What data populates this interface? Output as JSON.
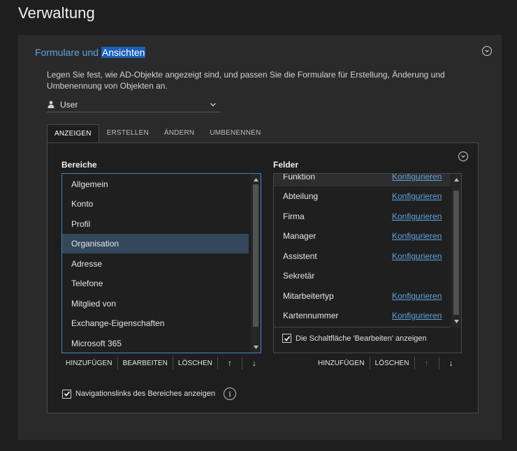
{
  "page": {
    "title": "Verwaltung"
  },
  "section": {
    "title_part1": "Formulare und ",
    "title_part2": "Ansichten",
    "description": "Legen Sie fest, wie AD-Objekte angezeigt sind, und passen Sie die Formulare für Erstellung, Änderung und Umbenennung von Objekten an."
  },
  "object_type": {
    "icon": "user-icon",
    "value": "User"
  },
  "tabs": [
    {
      "label": "ANZEIGEN",
      "active": true
    },
    {
      "label": "ERSTELLEN",
      "active": false
    },
    {
      "label": "ÄNDERN",
      "active": false
    },
    {
      "label": "UMBENENNEN",
      "active": false
    }
  ],
  "bereiche": {
    "label": "Bereiche",
    "items": [
      {
        "label": "Allgemein"
      },
      {
        "label": "Konto"
      },
      {
        "label": "Profil"
      },
      {
        "label": "Organisation",
        "selected": true
      },
      {
        "label": "Adresse"
      },
      {
        "label": "Telefone"
      },
      {
        "label": "Mitglied von"
      },
      {
        "label": "Exchange-Eigenschaften"
      },
      {
        "label": "Microsoft 365"
      }
    ],
    "toolbar": {
      "add": "HINZUFÜGEN",
      "edit": "BEARBEITEN",
      "delete": "LÖSCHEN",
      "up": "↑",
      "down": "↓"
    }
  },
  "felder": {
    "label": "Felder",
    "items": [
      {
        "label": "Funktion",
        "link": "Konfigurieren"
      },
      {
        "label": "Abteilung",
        "link": "Konfigurieren"
      },
      {
        "label": "Firma",
        "link": "Konfigurieren"
      },
      {
        "label": "Manager",
        "link": "Konfigurieren"
      },
      {
        "label": "Assistent",
        "link": "Konfigurieren"
      },
      {
        "label": "Sekretär",
        "link": ""
      },
      {
        "label": "Mitarbeitertyp",
        "link": "Konfigurieren"
      },
      {
        "label": "Kartennummer",
        "link": "Konfigurieren"
      }
    ],
    "edit_button_checkbox": {
      "label": "Die Schaltfläche 'Bearbeiten' anzeigen",
      "checked": true
    },
    "toolbar": {
      "add": "HINZUFÜGEN",
      "delete": "LÖSCHEN",
      "up": "↑",
      "down": "↓"
    }
  },
  "nav_links_checkbox": {
    "label": "Navigationslinks des Bereiches anzeigen",
    "checked": true,
    "info_icon": "info-icon",
    "info_glyph": "i"
  },
  "colors": {
    "accent": "#5fa3e0",
    "selection": "#34475b",
    "highlight": "#1b5fb8",
    "background": "#1e1e1e",
    "card": "#2a2a2a"
  }
}
